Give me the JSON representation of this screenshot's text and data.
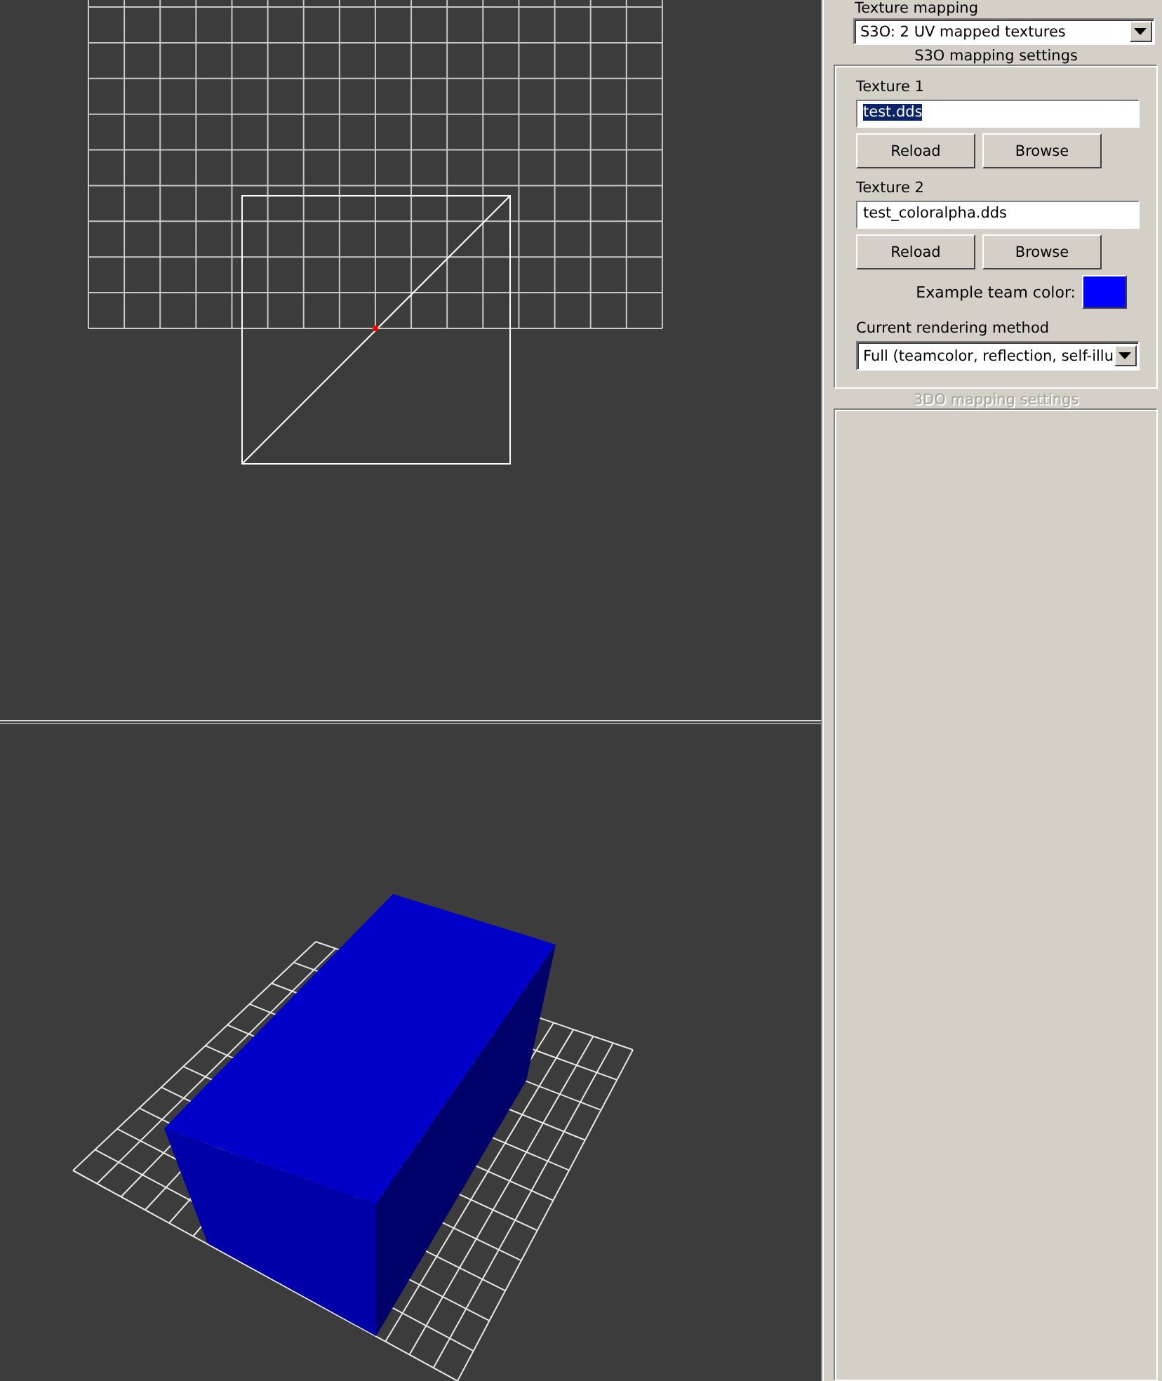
{
  "texture_mapping": {
    "label": "Texture mapping",
    "value": "S3O: 2 UV mapped textures"
  },
  "s3o_settings": {
    "title": "S3O mapping settings",
    "textures": [
      {
        "label": "Texture 1",
        "value": "test.dds",
        "text_selected": true,
        "buttons": [
          "Reload",
          "Browse"
        ]
      },
      {
        "label": "Texture 2",
        "value": "test_coloralpha.dds",
        "text_selected": false,
        "buttons": [
          "Reload",
          "Browse"
        ]
      }
    ],
    "team_color": {
      "label": "Example team color:",
      "color": "#0000ff"
    },
    "rendering_method": {
      "label": "Current rendering method",
      "value": "Full (teamcolor, reflection, self-illu"
    }
  },
  "o3do_settings": {
    "title": "3DO mapping settings",
    "disabled": true
  }
}
